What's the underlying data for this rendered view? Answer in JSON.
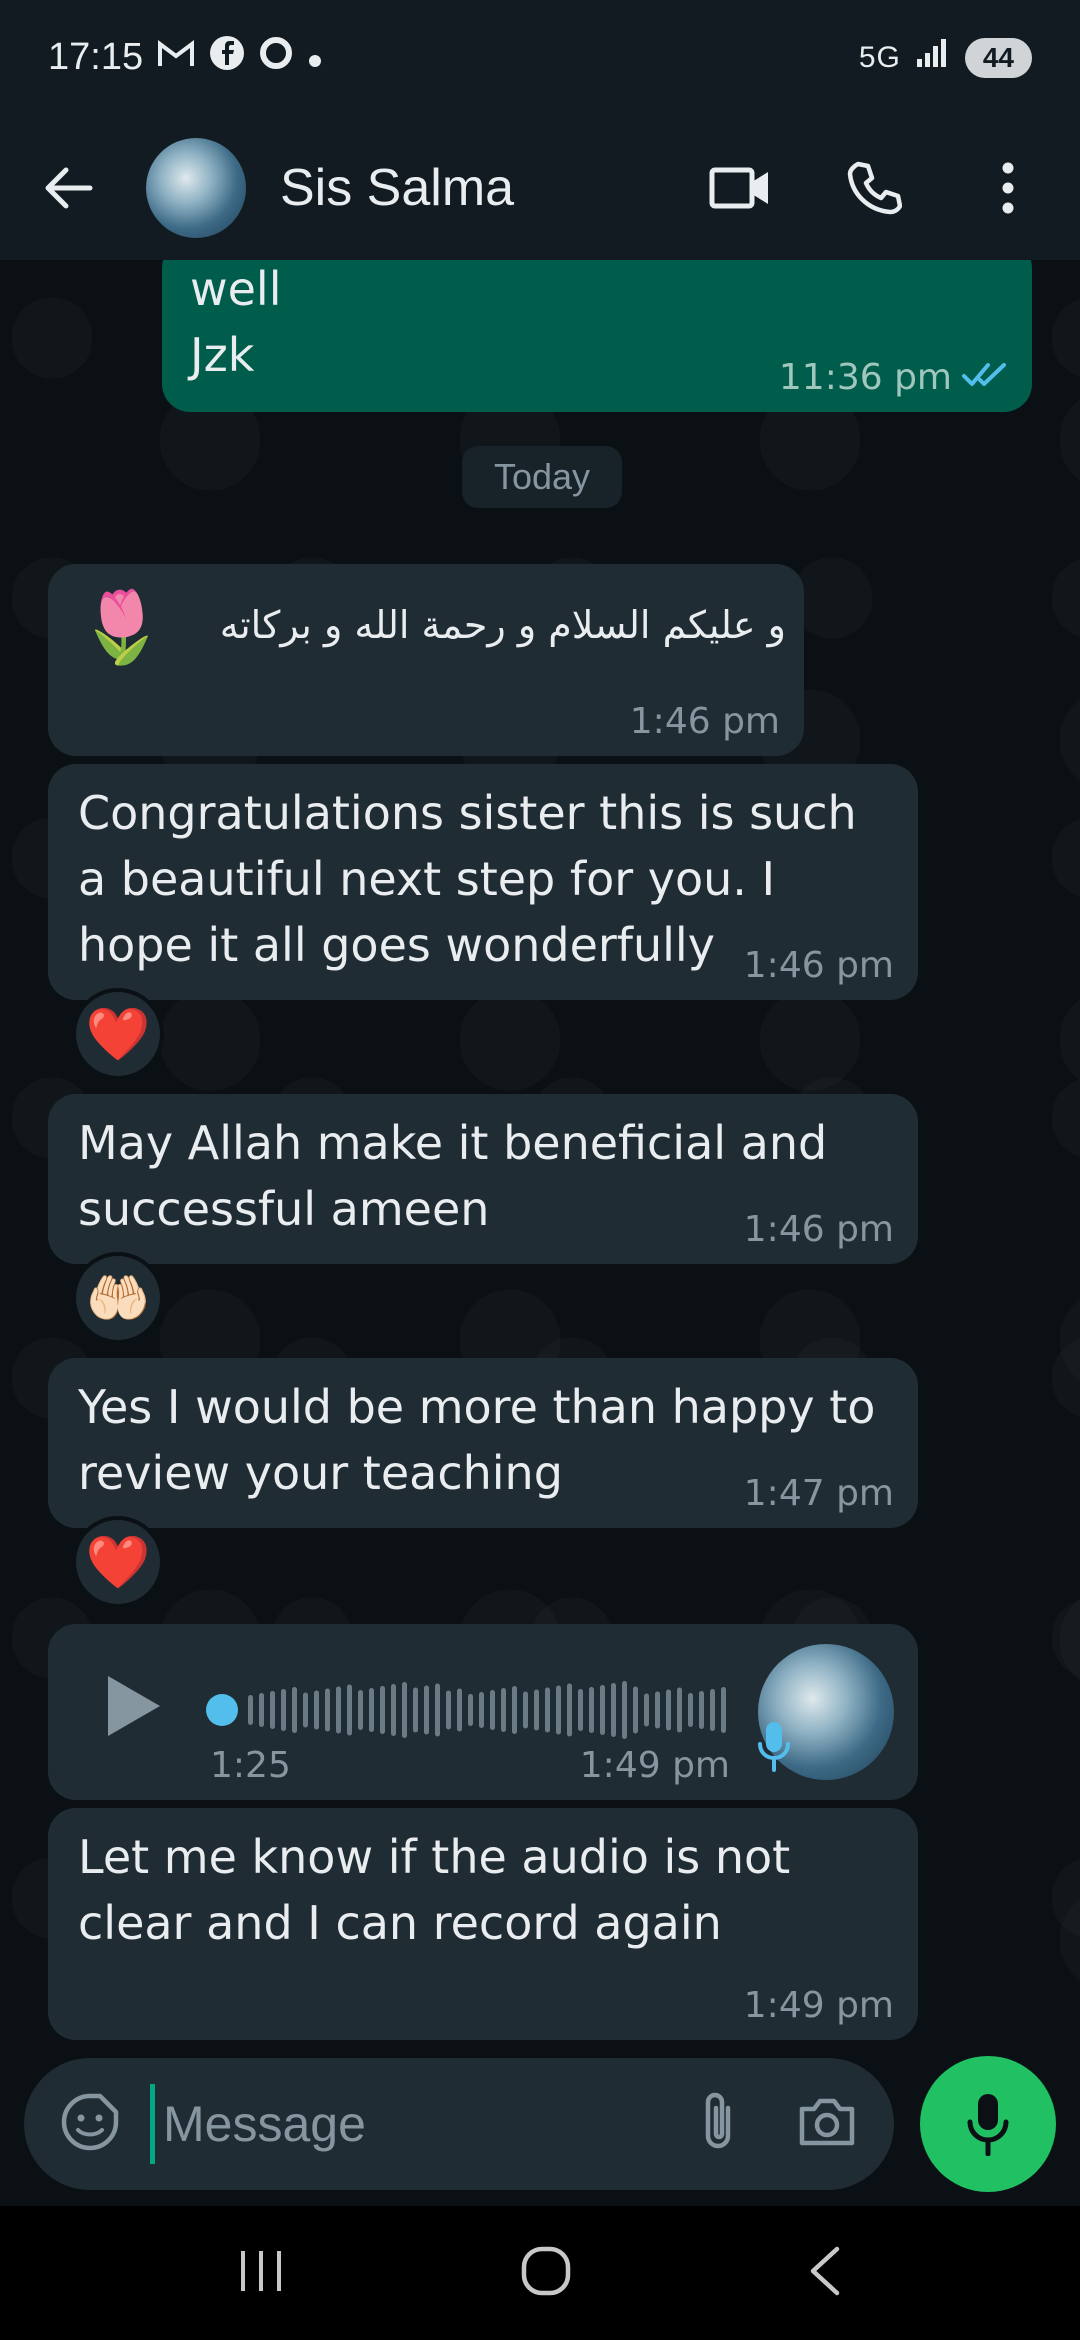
{
  "status_bar": {
    "time": "17:15",
    "battery": "44",
    "network": "5G",
    "notif_icons": [
      "gmail-icon",
      "facebook-icon",
      "opera-icon"
    ]
  },
  "header": {
    "contact_name": "Sis Salma"
  },
  "date_chip": "Today",
  "messages": [
    {
      "text": "well\nJzk",
      "time": "11:36 pm",
      "direction": "outgoing",
      "status": "read"
    },
    {
      "text": "و عليكم السلام و رحمة الله و بركاته",
      "emoji": "🌷",
      "time": "1:46 pm",
      "direction": "incoming"
    },
    {
      "text": "Congratulations sister this is such\na beautiful next step for you. I\nhope it all goes wonderfully",
      "time": "1:46 pm",
      "direction": "incoming",
      "reaction": "❤️"
    },
    {
      "text": "May Allah make it beneficial and\nsuccessful ameen",
      "time": "1:46 pm",
      "direction": "incoming",
      "reaction": "🤲🏻"
    },
    {
      "text": "Yes I would be more than happy to\nreview your teaching",
      "time": "1:47 pm",
      "direction": "incoming",
      "reaction": "❤️"
    },
    {
      "type": "voice",
      "duration": "1:25",
      "time": "1:49 pm",
      "direction": "incoming"
    },
    {
      "text": "Let me know if the audio is not\nclear and I can record again",
      "time": "1:49 pm",
      "direction": "incoming"
    }
  ],
  "input": {
    "placeholder": "Message"
  },
  "colors": {
    "accent": "#00a884",
    "mic_button": "#21c063",
    "outgoing_bubble": "#005c4b",
    "incoming_bubble": "#202c33",
    "read_ticks": "#53bdeb"
  }
}
